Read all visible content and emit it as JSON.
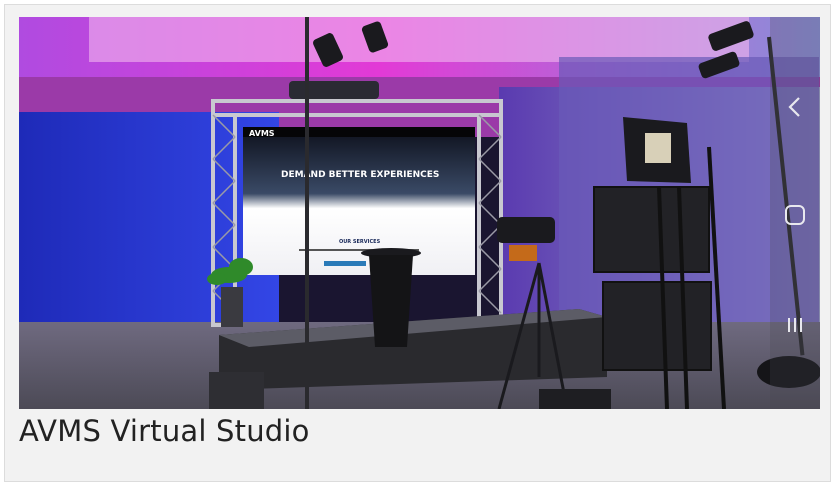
{
  "caption": "AVMS Virtual Studio",
  "photo": {
    "alt": "AVMS virtual studio stage with LED wall, truss, cameras and monitors",
    "screen": {
      "brand": "AVMS",
      "headline": "DEMAND BETTER EXPERIENCES",
      "services_title": "OUR SERVICES"
    }
  },
  "system_nav": {
    "back_icon": "chevron-left-icon",
    "home_icon": "home-icon",
    "recents_icon": "recents-icon"
  },
  "colors": {
    "card_bg": "#f2f2f2",
    "caption_text": "#222222",
    "stage_magenta": "#d63ad0",
    "stage_blue": "#2a3ad8"
  }
}
